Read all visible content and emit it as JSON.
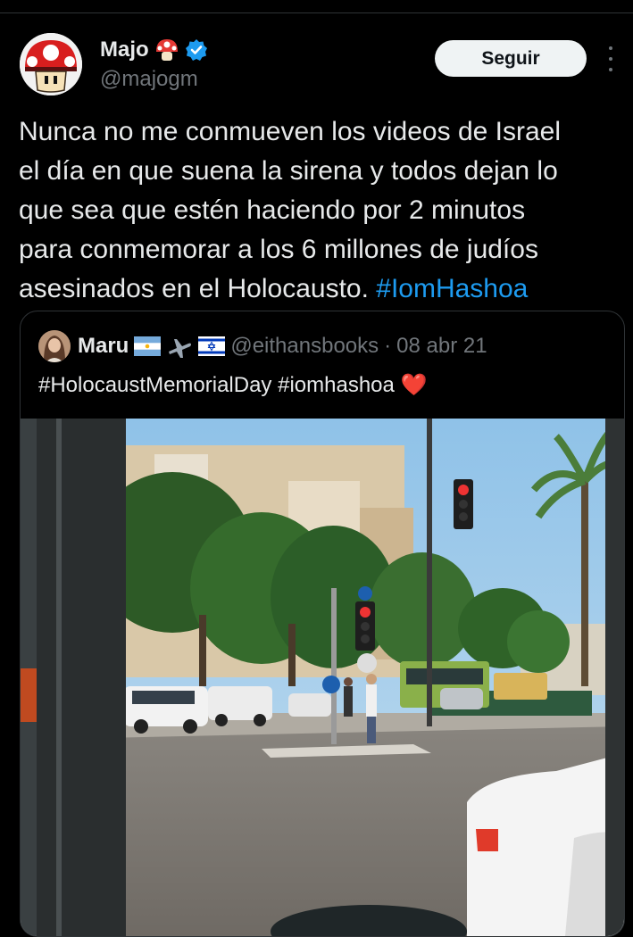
{
  "tweet": {
    "author_name": "Majo",
    "author_emoji": "mushroom-icon",
    "verified": true,
    "handle": "@majogm",
    "follow_label": "Seguir",
    "text_lines": [
      "Nunca no me conmueven los videos de Israel",
      "el día en que suena la sirena y todos dejan lo",
      "que sea que estén haciendo por 2 minutos",
      "para conmemorar a los 6 millones de judíos",
      "asesinados en el Holocausto. "
    ],
    "hashtag": "#IomHashoa"
  },
  "quote": {
    "author_name": "Maru",
    "flags": [
      "argentina-flag-icon",
      "airplane-icon",
      "israel-flag-icon"
    ],
    "handle": "@eithansbooks",
    "separator": "·",
    "date": "08 abr 21",
    "text": "#HolocaustMemorialDay #iomhashoa",
    "heart": "❤️"
  },
  "colors": {
    "background": "#000000",
    "text": "#e7e9ea",
    "secondary": "#71767b",
    "link": "#1d9bf0",
    "verified": "#1d9bf0",
    "border": "#2f3336",
    "follow_bg": "#eff3f4"
  }
}
